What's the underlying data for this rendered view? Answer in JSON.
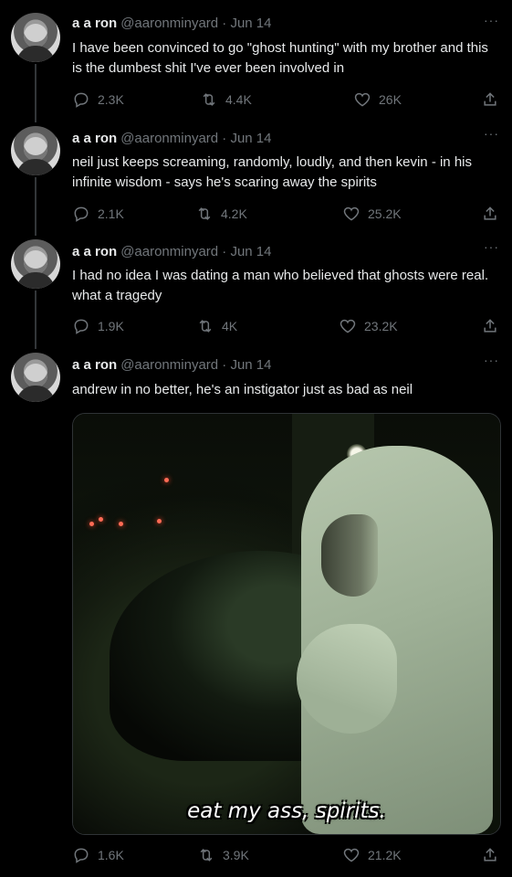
{
  "tweets": [
    {
      "name": "a a ron",
      "handle": "@aaronminyard · Jun 14",
      "text": "I have been convinced to go \"ghost hunting\" with my brother and this is the dumbest shit I've ever been involved in",
      "replies": "2.3K",
      "retweets": "4.4K",
      "likes": "26K"
    },
    {
      "name": "a a ron",
      "handle": "@aaronminyard · Jun 14",
      "text": "neil just keeps screaming, randomly, loudly, and then kevin - in his infinite wisdom - says he's scaring away the spirits",
      "replies": "2.1K",
      "retweets": "4.2K",
      "likes": "25.2K"
    },
    {
      "name": "a a ron",
      "handle": "@aaronminyard · Jun 14",
      "text": "I had no idea I was dating a man who believed that ghosts were real. what a tragedy",
      "replies": "1.9K",
      "retweets": "4K",
      "likes": "23.2K"
    },
    {
      "name": "a a ron",
      "handle": "@aaronminyard · Jun 14",
      "text": "andrew in no better, he's an instigator just as bad as neil",
      "replies": "1.6K",
      "retweets": "3.9K",
      "likes": "21.2K",
      "media_caption": "eat my ass, spirits."
    }
  ],
  "more_label": "···",
  "colors": {
    "background": "#000000",
    "text": "#e7e9ea",
    "muted": "#71767b"
  },
  "icons": [
    "reply-icon",
    "retweet-icon",
    "like-icon",
    "share-icon",
    "more-icon"
  ]
}
